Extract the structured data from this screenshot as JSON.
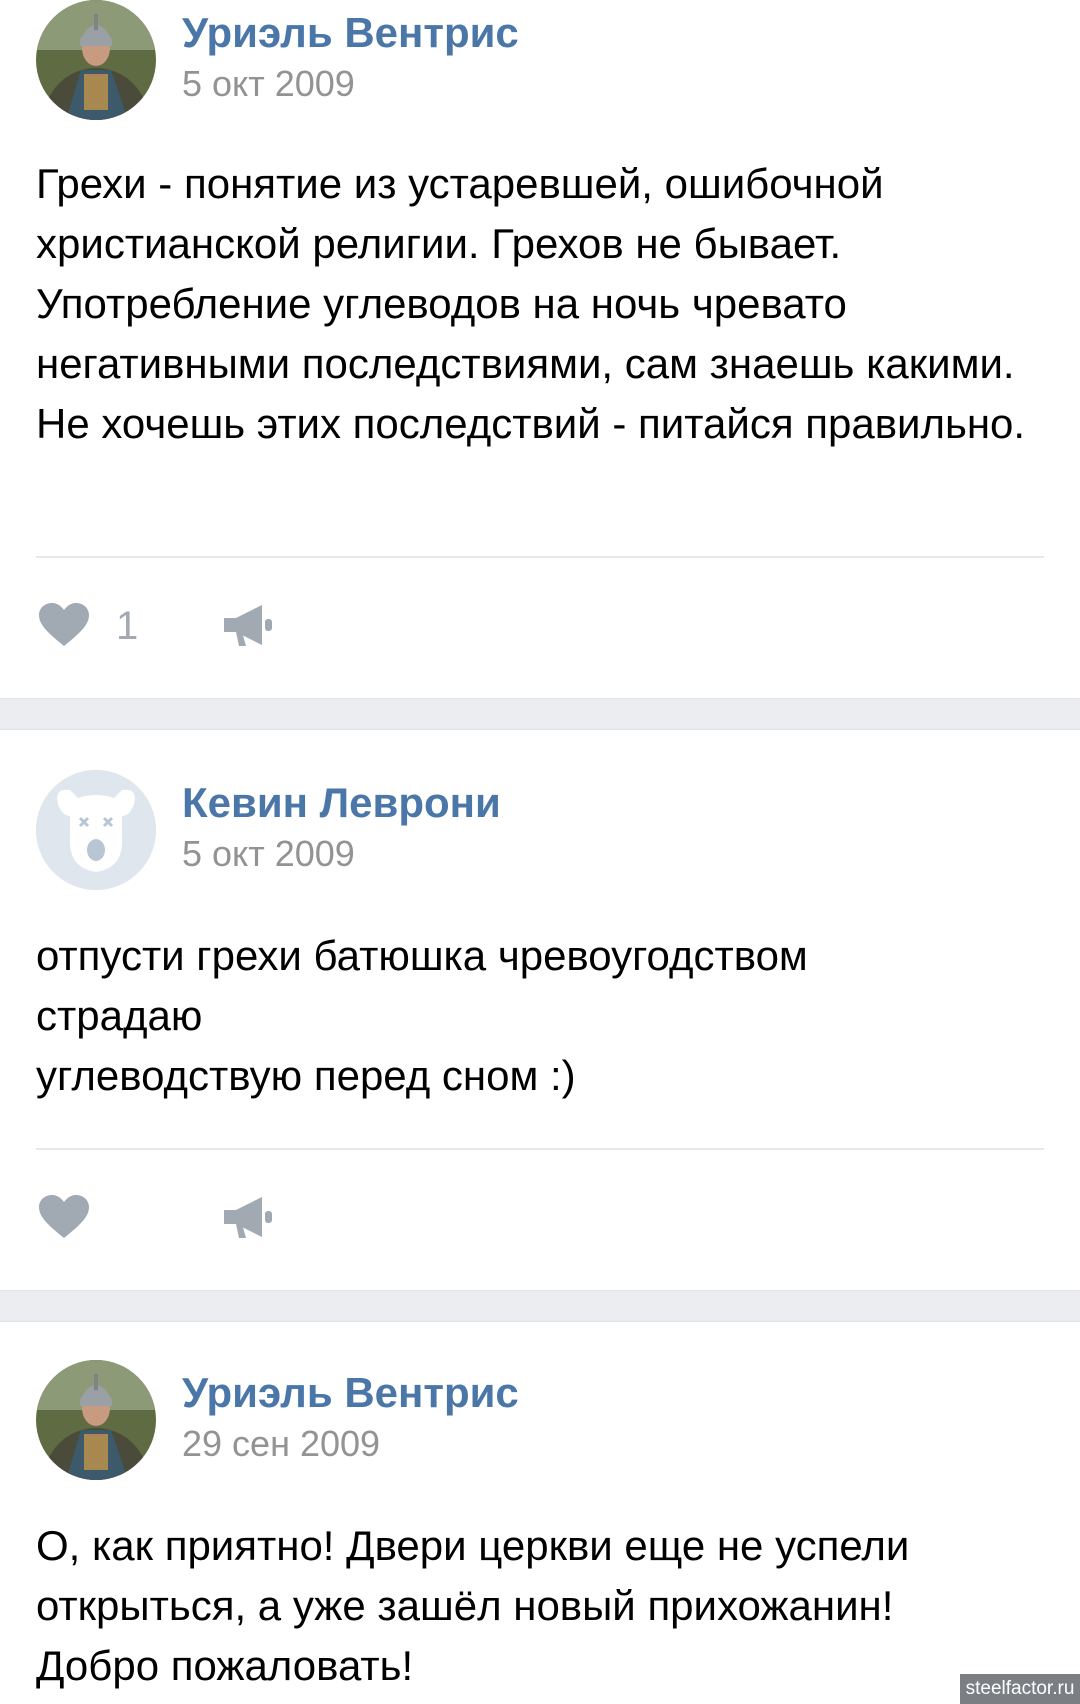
{
  "posts": [
    {
      "author": "Уриэль Вентрис",
      "date": "5 окт 2009",
      "text": "Грехи - понятие из устаревшей, ошибочной христианской религии. Грехов не бывает. Употребление углеводов на ночь чревато негативными последствиями, сам знаешь какими. Не хочешь этих последствий - питайся правильно.",
      "likes": "1"
    },
    {
      "author": "Кевин Леврони",
      "date": "5 окт 2009",
      "text": "отпусти грехи батюшка чревоугодством страдаю\nуглеводствую перед сном :)",
      "likes": ""
    },
    {
      "author": "Уриэль Вентрис",
      "date": "29 сен 2009",
      "text": "О, как приятно! Двери церкви еще не успели открыться, а уже зашёл новый прихожанин! Добро пожаловать!"
    }
  ],
  "icons": {
    "like": "heart-icon",
    "share": "megaphone-icon"
  },
  "colors": {
    "author": "#4a76a8",
    "date": "#939393",
    "icon": "#a1a9b3",
    "separator": "#ebedf0"
  },
  "watermark": "steelfactor.ru"
}
